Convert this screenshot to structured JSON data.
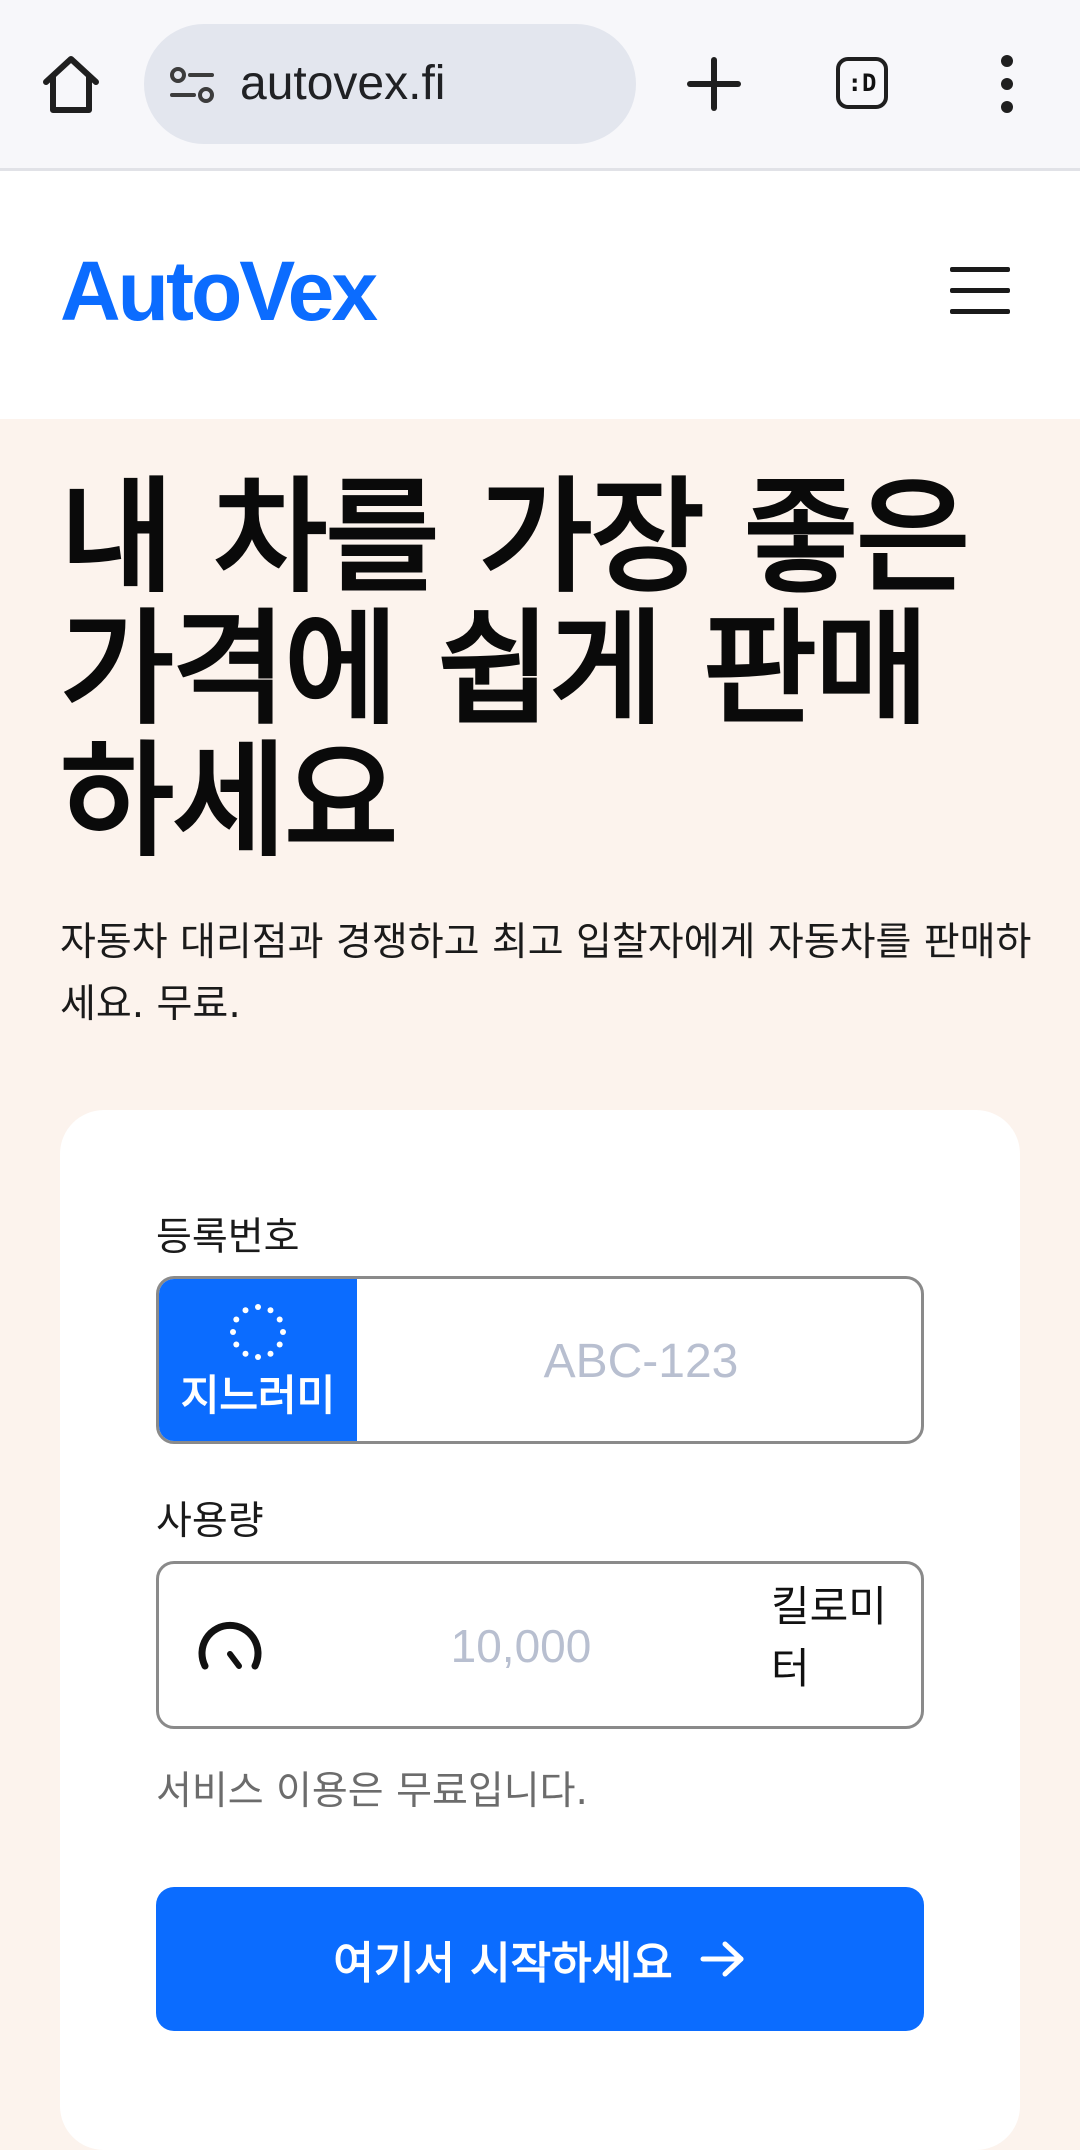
{
  "browser": {
    "url": "autovex.fi",
    "tab_count": ":D"
  },
  "header": {
    "logo": "AutoVex"
  },
  "hero": {
    "title": "내 차를 가장 좋은 가격에 쉽게 판매하세요",
    "subtitle": "자동차 대리점과 경쟁하고 최고 입찰자에게 자동차를 판매하세요. 무료."
  },
  "form": {
    "plate_label": "등록번호",
    "plate_country": "지느러미",
    "plate_placeholder": "ABC-123",
    "mileage_label": "사용량",
    "mileage_placeholder": "10,000",
    "mileage_unit": "킬로미터",
    "free_note": "서비스 이용은 무료입니다.",
    "cta_label": "여기서 시작하세요"
  },
  "colors": {
    "brand": "#0b6cff",
    "hero_bg": "#fcf3ed"
  }
}
